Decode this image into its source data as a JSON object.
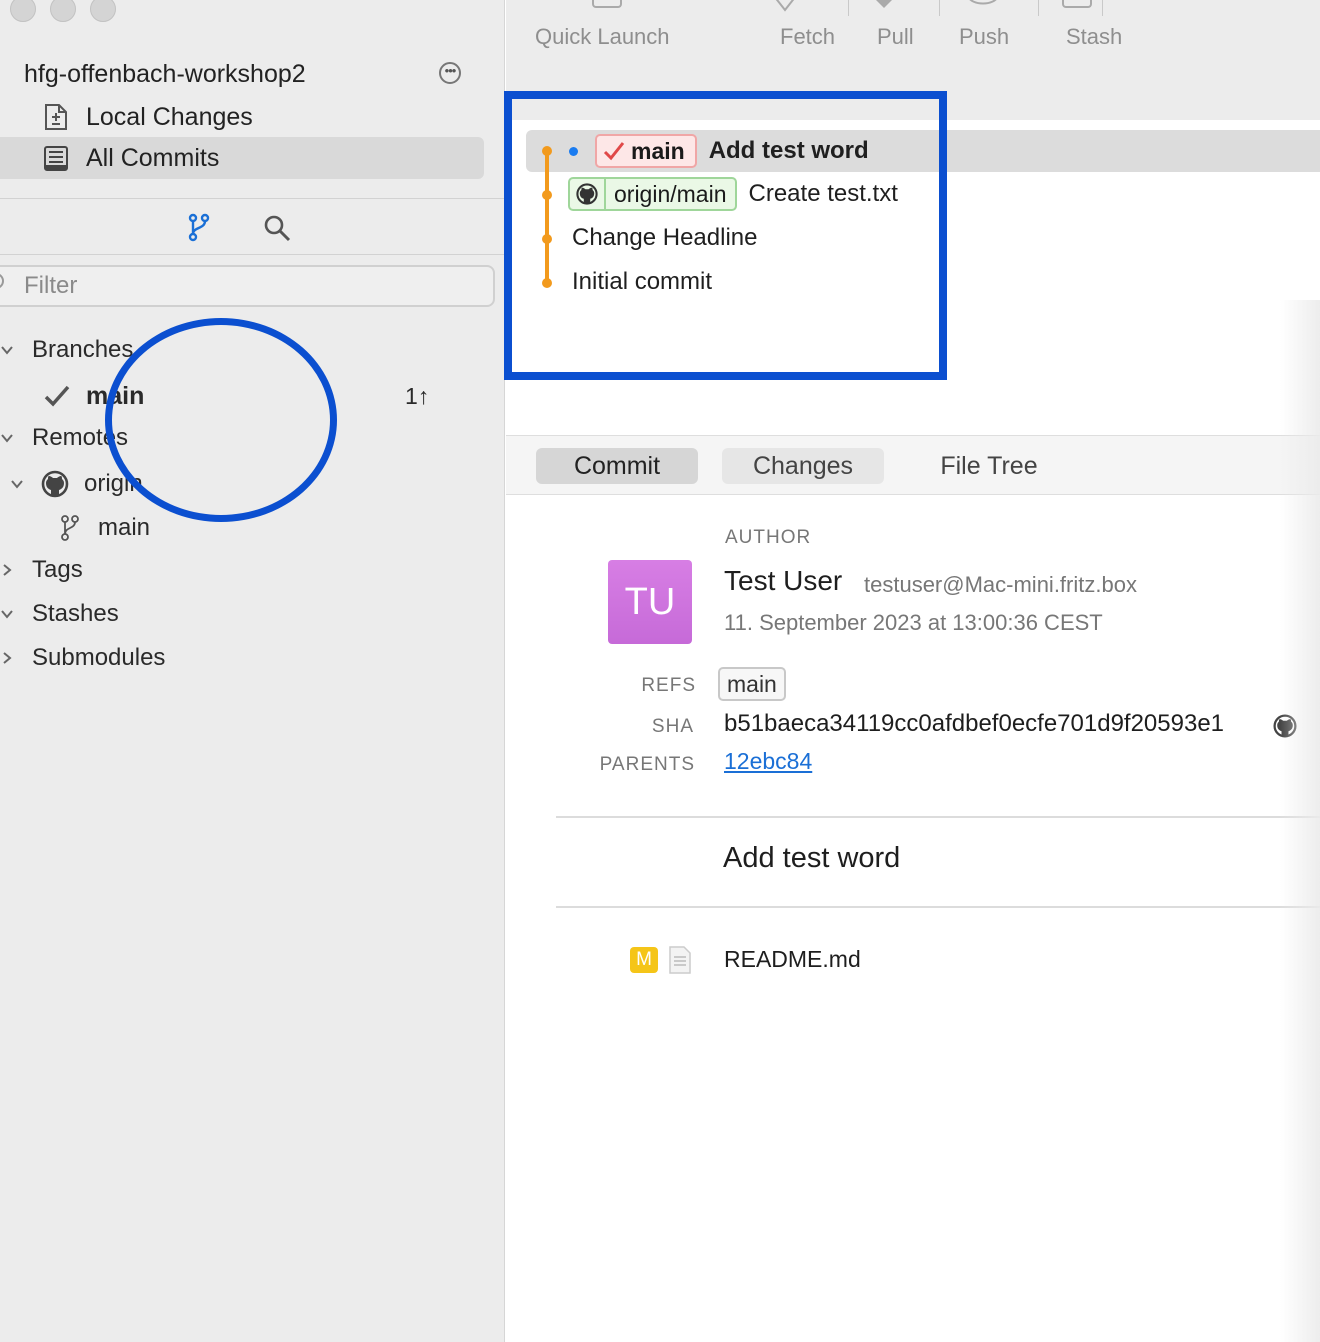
{
  "sidebar": {
    "repo_name": "hfg-offenbach-workshop2",
    "nav": [
      {
        "label": "Local Changes",
        "icon": "local-changes-icon"
      },
      {
        "label": "All Commits",
        "icon": "all-commits-icon"
      }
    ],
    "filter_placeholder": "Filter",
    "tree": {
      "branches": "Branches",
      "branch_main": "main",
      "branch_main_status": "1↑",
      "remotes": "Remotes",
      "origin": "origin",
      "origin_main": "main",
      "tags": "Tags",
      "stashes": "Stashes",
      "submodules": "Submodules"
    }
  },
  "toolbar": {
    "quick_launch": "Quick Launch",
    "fetch": "Fetch",
    "pull": "Pull",
    "push": "Push",
    "stash": "Stash"
  },
  "history": {
    "commits": [
      {
        "message": "Add test word",
        "ref": "main"
      },
      {
        "message": "Create test.txt",
        "ref": "origin/main"
      },
      {
        "message": "Change Headline"
      },
      {
        "message": "Initial commit"
      }
    ]
  },
  "tabs": [
    "Commit",
    "Changes",
    "File Tree"
  ],
  "details": {
    "author_label": "AUTHOR",
    "avatar_initials": "TU",
    "author_name": "Test User",
    "author_email": "testuser@Mac-mini.fritz.box",
    "date": "11. September 2023 at 13:00:36 CEST",
    "refs_label": "REFS",
    "refs_value": "main",
    "sha_label": "SHA",
    "sha_value": "b51baeca34119cc0afdbef0ecfe701d9f20593e1",
    "parents_label": "PARENTS",
    "parents_value": "12ebc84",
    "message": "Add test word",
    "files": [
      {
        "status": "M",
        "name": "README.md"
      }
    ]
  },
  "colors": {
    "graph": "#f29a1d",
    "annotation": "#0b4fd0",
    "link": "#1a6fd6",
    "modified_badge": "#f5c518"
  }
}
